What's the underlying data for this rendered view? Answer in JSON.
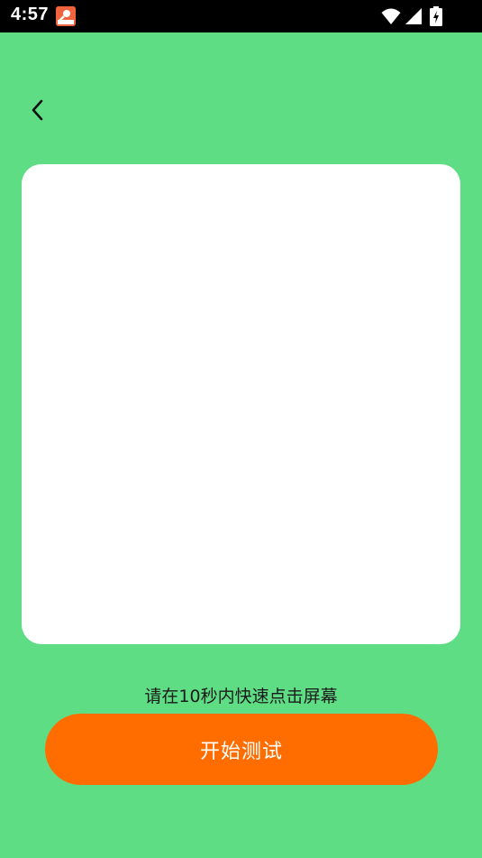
{
  "status_bar": {
    "time": "4:57",
    "icons": [
      "app-notification-icon",
      "wifi-icon",
      "signal-icon",
      "battery-charging-icon"
    ]
  },
  "navigation": {
    "back_icon": "chevron-left-icon"
  },
  "test": {
    "instruction": "请在10秒内快速点击屏幕",
    "start_label": "开始测试"
  },
  "colors": {
    "background": "#5fdd85",
    "card": "#ffffff",
    "button": "#ff6d00",
    "status_bar": "#000000"
  }
}
